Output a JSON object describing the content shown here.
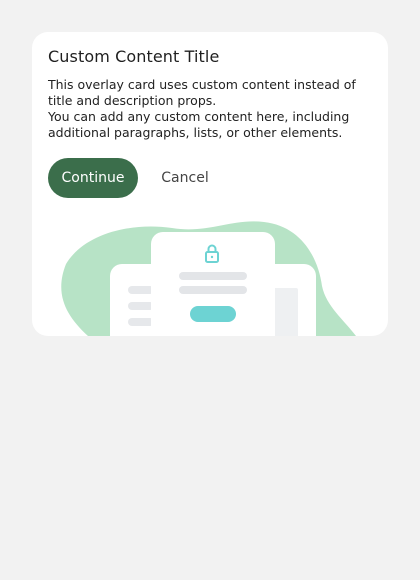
{
  "card": {
    "title": "Custom Content Title",
    "paragraph_1": "This overlay card uses custom content instead of title and description props.",
    "paragraph_2": "You can add any custom content here, including additional paragraphs, lists, or other elements."
  },
  "actions": {
    "continue_label": "Continue",
    "cancel_label": "Cancel"
  },
  "colors": {
    "primary": "#3b6e4b",
    "blob": "#b7e3c6",
    "accent_teal": "#6dd3d3",
    "background": "#f2f2f2"
  },
  "illustration": {
    "icon": "lock-icon"
  }
}
